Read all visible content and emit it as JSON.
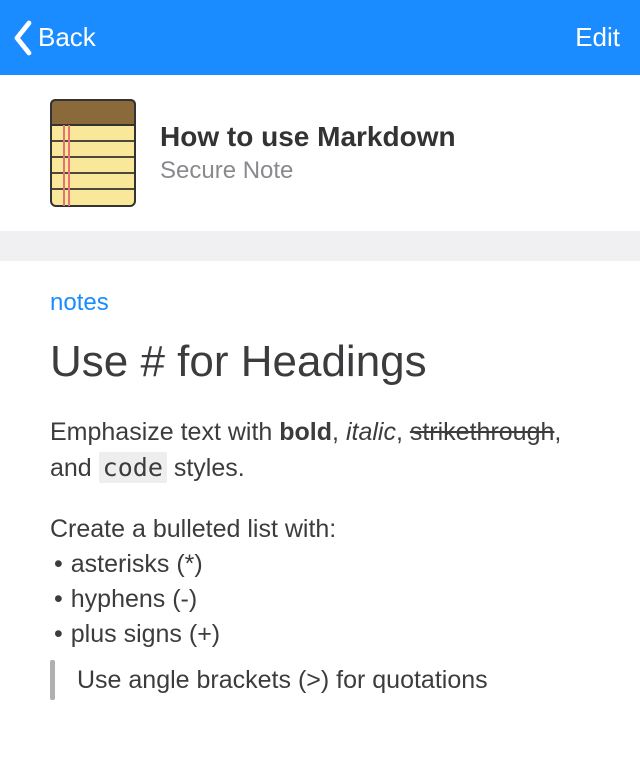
{
  "navbar": {
    "back_label": "Back",
    "edit_label": "Edit"
  },
  "header": {
    "title": "How to use Markdown",
    "subtitle": "Secure Note"
  },
  "content": {
    "section_label": "notes",
    "heading": "Use # for Headings",
    "emphasis_pre": "Emphasize text with ",
    "emphasis_bold": "bold",
    "emphasis_sep1": ", ",
    "emphasis_italic": "italic",
    "emphasis_sep2": ", ",
    "emphasis_strike": "strikethrough",
    "emphasis_sep3": ", and ",
    "emphasis_code": "code",
    "emphasis_post": " styles.",
    "list_intro": "Create a bulleted list with:",
    "bullets": [
      "asterisks (*)",
      "hyphens (-)",
      "plus signs (+)"
    ],
    "blockquote": "Use angle brackets (>) for quotations"
  }
}
